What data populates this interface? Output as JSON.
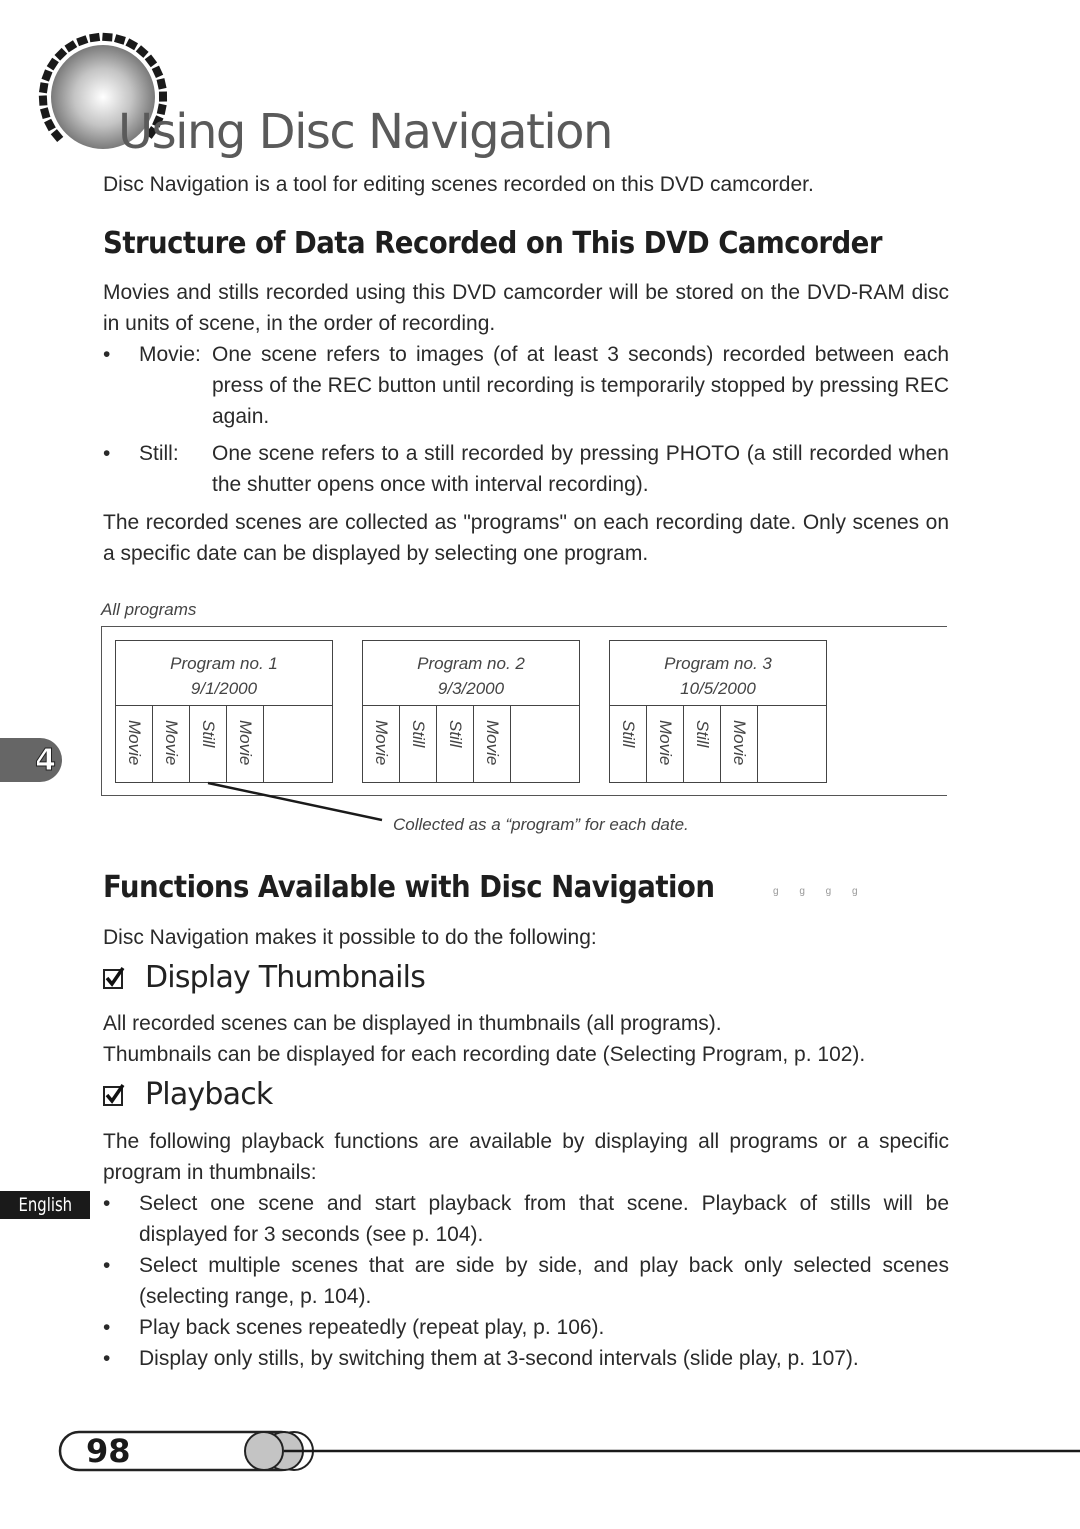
{
  "header": {
    "title": "Using Disc Navigation",
    "lead": "Disc Navigation is a tool for editing scenes recorded on this DVD camcorder."
  },
  "section1": {
    "heading": "Structure of Data Recorded on This DVD Camcorder",
    "intro": "Movies and stills recorded using this DVD camcorder will be stored on the DVD-RAM disc in units of scene, in the order of recording.",
    "definitions": [
      {
        "term": "Movie:",
        "text": "One scene refers to images (of at least 3 seconds) recorded between each press of the REC button until recording is temporarily stopped by pressing REC again."
      },
      {
        "term": "Still:",
        "text": "One scene refers to a still recorded by pressing PHOTO (a still recorded when the shutter opens once with interval recording)."
      }
    ],
    "outro": "The recorded scenes are collected as \"programs\" on each recording date. Only scenes on a specific date can be displayed by selecting one program."
  },
  "diagram": {
    "label": "All programs",
    "caption": "Collected as a “program” for each date.",
    "programs": [
      {
        "name": "Program no. 1",
        "date": "9/1/2000",
        "scenes": [
          "Movie",
          "Movie",
          "Still",
          "Movie"
        ]
      },
      {
        "name": "Program no. 2",
        "date": "9/3/2000",
        "scenes": [
          "Movie",
          "Still",
          "Still",
          "Movie"
        ]
      },
      {
        "name": "Program no. 3",
        "date": "10/5/2000",
        "scenes": [
          "Still",
          "Movie",
          "Still",
          "Movie"
        ]
      }
    ]
  },
  "section2": {
    "heading": "Functions Available with Disc Navigation",
    "heading_marks": "g g g g",
    "intro": "Disc Navigation makes it possible to do the following:",
    "display": {
      "heading": "Display Thumbnails",
      "lines": [
        "All recorded scenes can be displayed in thumbnails (all programs).",
        "Thumbnails can be displayed for each recording date (Selecting Program, p. 102)."
      ]
    },
    "playback": {
      "heading": "Playback",
      "intro": "The following playback functions are available by displaying all programs or a specific program in thumbnails:",
      "bullets": [
        "Select one scene and start playback from that scene. Playback of stills will be displayed for 3 seconds (see p. 104).",
        "Select multiple scenes that are side by side, and play back only selected scenes (selecting range, p. 104).",
        "Play back scenes repeatedly (repeat play, p. 106).",
        "Display only stills, by switching them at 3-second intervals (slide play, p. 107)."
      ]
    }
  },
  "sidebar": {
    "chapter": "4",
    "language": "English"
  },
  "footer": {
    "page_number": "98"
  },
  "bullet_char": "•"
}
